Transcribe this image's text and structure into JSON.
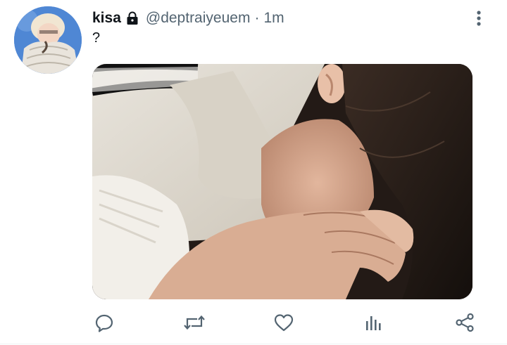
{
  "tweet": {
    "author": {
      "display_name": "kisa",
      "handle": "@deptraiyeuem",
      "protected_icon": "lock-icon"
    },
    "separator": "·",
    "time": "1m",
    "text": "?",
    "more_icon": "more-vertical-icon"
  },
  "actions": [
    {
      "name": "reply",
      "icon": "reply-icon"
    },
    {
      "name": "retweet",
      "icon": "retweet-icon"
    },
    {
      "name": "like",
      "icon": "heart-icon"
    },
    {
      "name": "analytics",
      "icon": "analytics-icon"
    },
    {
      "name": "share",
      "icon": "share-icon"
    }
  ],
  "colors": {
    "text": "#0f1419",
    "secondary": "#536471",
    "icon": "#536471",
    "avatar_bg": "#5b8ed6",
    "divider": "#eff3f4"
  }
}
